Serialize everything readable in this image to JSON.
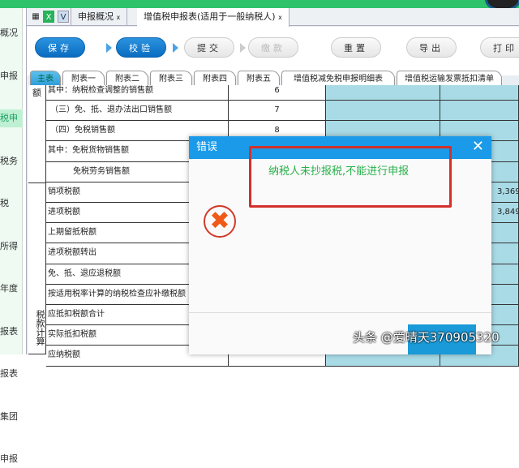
{
  "sidebar": {
    "items": [
      "概况",
      "申报",
      "税申",
      "税务",
      "税",
      "所得",
      "年度",
      "报表",
      "报表",
      "集团",
      "申报"
    ],
    "active_index": 2
  },
  "tabs": {
    "icon_grid": "grid-icon",
    "icon_excel": "X",
    "icon_down": "V",
    "items": [
      {
        "label": "申报概况",
        "close": "x"
      },
      {
        "label": "增值税申报表(适用于一般纳税人)",
        "close": "x"
      }
    ]
  },
  "toolbar": {
    "save": "保存",
    "check": "校验",
    "submit": "提交",
    "pay": "缴款",
    "reset": "重置",
    "export": "导出",
    "print": "打印"
  },
  "subtabs": [
    "主表",
    "附表一",
    "附表二",
    "附表三",
    "附表四",
    "附表五",
    "增值税减免税申报明细表",
    "增值税运输发票抵扣清单"
  ],
  "table": {
    "group_labels": [
      "额",
      "税款计算"
    ],
    "rows": [
      {
        "name": "其中：纳税检查调整的销售额",
        "no": "6",
        "value": ""
      },
      {
        "name": "（三）免、抵、退办法出口销售额",
        "no": "7",
        "value": ""
      },
      {
        "name": "（四）免税销售额",
        "no": "8",
        "value": ""
      },
      {
        "name": "其中：免税货物销售额",
        "no": "",
        "value": ""
      },
      {
        "name": "免税劳务销售额",
        "no": "",
        "value": ""
      },
      {
        "name": "销项税额",
        "no": "",
        "value": "3,369"
      },
      {
        "name": "进项税额",
        "no": "",
        "value": "3,849"
      },
      {
        "name": "上期留抵税额",
        "no": "",
        "value": ""
      },
      {
        "name": "进项税额转出",
        "no": "",
        "value": ""
      },
      {
        "name": "免、抵、退应退税额",
        "no": "",
        "value": ""
      },
      {
        "name": "按适用税率计算的纳税检查应补缴税额",
        "no": "",
        "value": ""
      },
      {
        "name": "应抵扣税额合计",
        "no": "",
        "value": ""
      },
      {
        "name": "实际抵扣税额",
        "no": "",
        "value": ""
      },
      {
        "name": "应纳税额",
        "no": "",
        "value": ""
      }
    ]
  },
  "dialog": {
    "title": "错误",
    "close": "✕",
    "message": "纳税人未抄报税,不能进行申报",
    "icon": "✖"
  },
  "watermark": "头条 @爱晴天370905320"
}
